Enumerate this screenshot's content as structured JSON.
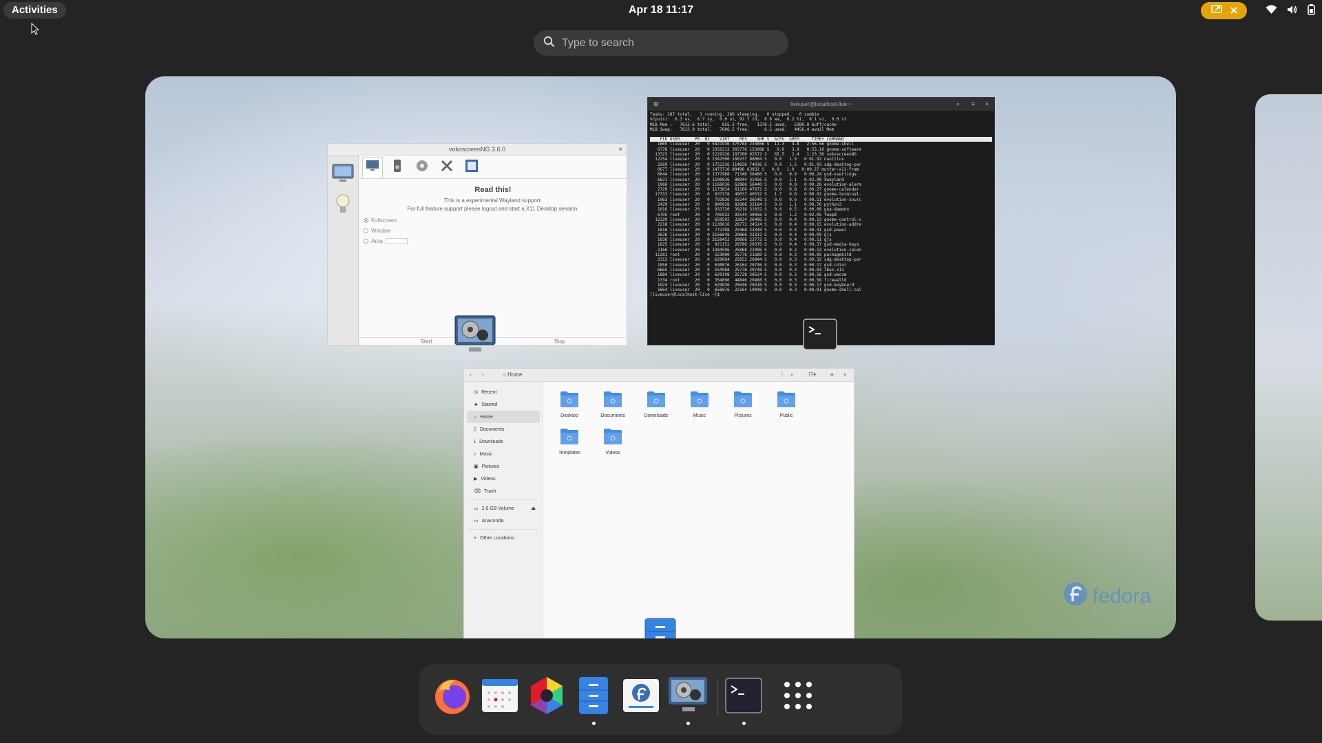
{
  "topbar": {
    "activities_label": "Activities",
    "clock": "Apr 18  11:17",
    "screencast_indicator_color": "#e5a50a"
  },
  "search": {
    "placeholder": "Type to search"
  },
  "vokoscreen": {
    "title": "vokoscreenNG 3.6.0",
    "heading": "Read this!",
    "message_line1": "This is a experimental Wayland support.",
    "message_line2": "For full feature support please logout and start a X11 Desktop session.",
    "options": [
      "Fullscreen",
      "Window",
      "Area"
    ],
    "start_label": "Start",
    "stop_label": "Stop"
  },
  "terminal": {
    "title": "liveuser@localhost-live:~",
    "summary": [
      "Tasks: 287 total,   1 running, 286 sleeping,   0 stopped,   0 zombie",
      "%Cpu(s):  6.3 us,  6.7 sy,  0.0 ni, 92.7 id,  0.0 wa,  0.2 hi,  0.1 si,  0.0 st",
      "MiB Mem :   7613.6 total,    855.2 free,   1378.5 used,   5380.0 buff/cache",
      "MiB Swap:   7613.0 total,   7606.5 free,      6.5 used.   4456.4 avail Mem"
    ],
    "header": "    PID USER      PR  NI    VIRT    RES    SHR S  %CPU  %MEM     TIME+ COMMAND",
    "rows": [
      "   1665 liveuser  20   0 5821936 375784 233856 S  11.3   4.8   2:56.56 gnome-shell",
      "   6778 liveuser  20   0 3356212 303776 153086 S   0.0   3.9   0:53.10 gnome-software",
      "  13323 liveuser  20   0 2229326 187760 92572 S   65.5   2.4   1:23.36 vokoscreenNG",
      "  12254 liveuser  20   0 2342500 160237 88064 S   0.0   1.9   0:01.92 nautilus",
      "   2269 liveuser  20   0 1752336 114836 74036 S   0.0   1.5   0:01.03 xdg-desktop-por",
      "   6677 liveuser  20   0 1473716 80496 63032 S   0.0   1.0   0:00.27 mutter-x11-fram",
      "   6644 liveuser  20   0 1377968  71346 56460 S   0.0   0.9   0:00.24 gsd-xsettings",
      "   6621 liveuser  20   0 1100036  88944 31456 S   0.0   1.1   0:02.90 Xwayland",
      "   1966 liveuser  20   0 1166036  62866 56440 S   0.0   0.8   0:00.26 evolution-alarm",
      "   2729 liveuser  20   0 1173024  61166 47672 S   0.0   0.8   0:00.27 gnome-calendar",
      "  17333 liveuser  20   0  837178  49037 40532 S   1.7   0.6   0:00.92 gnome-terminal-",
      "   1963 liveuser  20   0  792836  65144 36548 S   0.0   0.6   0:00.11 evolution-sourc",
      "   2429 liveuser  20   0  800928  82806 32184 S   0.0   1.1   0:00.76 python3",
      "   1816 liveuser  20   0  933730  39216 31032 S   0.0   0.5   0:00.08 goa-daemon",
      "   6795 root      20   0  705932  92544 30056 S   0.0   1.2   0:02.05 fwupd",
      "  12329 liveuser  20   0  659592  33824 26406 S   0.0   0.4   0:00.13 gnome-control-c",
      "   2218 liveuser  20   0 1130616  28772 24524 S   0.0   0.4   0:00.15 evolution-addre",
      "   1816 liveuser  20   0  772398  29368 23348 S   0.0   0.4   0:00.41 gsd-power",
      "   2636 liveuser  20   0 3156648  20866 23332 S   0.0   0.4   0:00.09 gjs",
      "   1836 liveuser  20   0 3158452  20866 23772 S   0.0   0.4   0:00.11 gjs",
      "   1825 liveuser  20   0  921152  28786 20376 S   0.0   0.4   0:00.37 gsd-media-keys",
      "   2166 liveuser  20   0 1384596  25868 22096 S   0.0   0.3   0:00.13 evolution-calen",
      "  11381 root      20   0  553000  25776 21680 S   0.0   0.3   0:00.05 packagekitd",
      "   2313 liveuser  20   0  629064  25652 20844 S   0.0   0.3   0:00.32 xdg-desktop-por",
      "   1850 liveuser  20   0  630076  26164 20796 S   0.0   0.3   0:00.17 gsd-color",
      "   6665 liveuser  20   0  554968  25776 20748 S   0.0   0.3   0:00.03 ibus-x11",
      "   1884 liveuser  20   0  629198  25728 20524 S   0.0   0.3   0:00.16 gsd-wacom",
      "   1334 root      20   0  354696  44846 20468 S   0.0   0.3   0:00.58 firewalld",
      "   1824 liveuser  20   0  629836  25646 20416 S   0.0   0.3   0:00.17 gsd-keyboard",
      "   1664 liveuser  20   0  656876  22164 19048 S   0.0   0.3   0:00.01 gnome-shell-cal"
    ],
    "prompt": "[liveuser@localhost-live ~]$ "
  },
  "files": {
    "path_label": "Home",
    "sidebar": [
      {
        "label": "Recent",
        "icon": "clock-icon"
      },
      {
        "label": "Starred",
        "icon": "star-icon"
      },
      {
        "label": "Home",
        "icon": "home-icon"
      },
      {
        "label": "Documents",
        "icon": "document-icon"
      },
      {
        "label": "Downloads",
        "icon": "download-icon"
      },
      {
        "label": "Music",
        "icon": "music-icon"
      },
      {
        "label": "Pictures",
        "icon": "picture-icon"
      },
      {
        "label": "Videos",
        "icon": "video-icon"
      },
      {
        "label": "Trash",
        "icon": "trash-icon"
      }
    ],
    "volumes": [
      {
        "label": "2.0 GB Volume",
        "icon": "drive-icon"
      },
      {
        "label": "Anaconda",
        "icon": "drive-icon"
      }
    ],
    "other_locations": "Other Locations",
    "folders": [
      "Desktop",
      "Documents",
      "Downloads",
      "Music",
      "Pictures",
      "Public",
      "Templates",
      "Videos"
    ]
  },
  "workspace": {
    "watermark": "fedora"
  },
  "dash": {
    "apps": [
      {
        "name": "Firefox",
        "icon": "firefox-icon",
        "running": false
      },
      {
        "name": "Calendar",
        "icon": "calendar-icon",
        "running": false
      },
      {
        "name": "Software",
        "icon": "software-icon",
        "running": false
      },
      {
        "name": "Files",
        "icon": "files-icon",
        "running": true
      },
      {
        "name": "Install to Hard Drive",
        "icon": "fedora-install-icon",
        "running": false
      },
      {
        "name": "vokoscreenNG",
        "icon": "vokoscreen-icon",
        "running": true
      },
      {
        "name": "Terminal",
        "icon": "terminal-icon",
        "running": true
      },
      {
        "name": "Show Apps",
        "icon": "app-grid-icon",
        "running": false
      }
    ]
  }
}
